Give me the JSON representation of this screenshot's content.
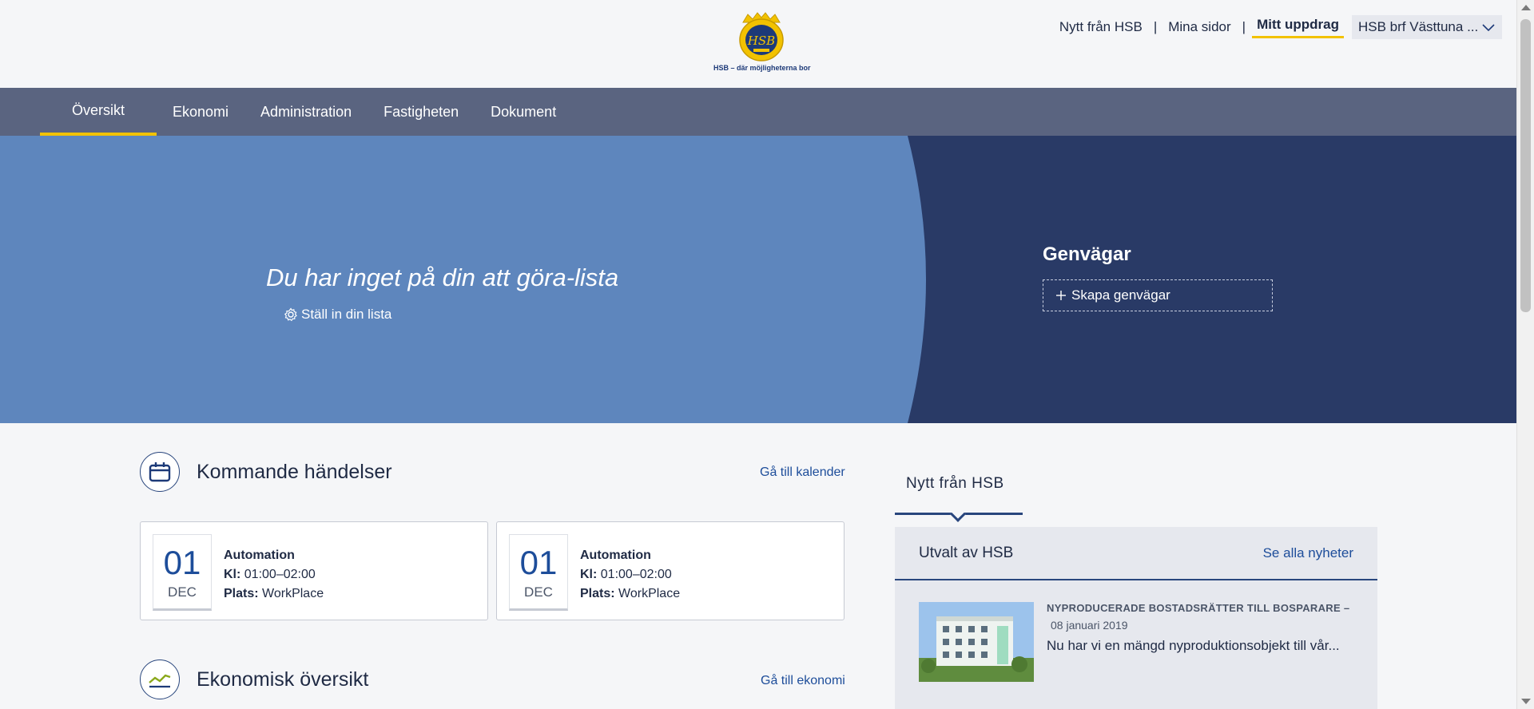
{
  "header": {
    "logo_tagline": "HSB – där möjligheterna bor",
    "topnav": {
      "news": "Nytt från HSB",
      "my_pages": "Mina sidor",
      "my_assignment": "Mitt uppdrag",
      "organization": "HSB brf Västtuna ..."
    }
  },
  "mainnav": {
    "items": [
      "Översikt",
      "Ekonomi",
      "Administration",
      "Fastigheten",
      "Dokument"
    ],
    "active": "Översikt"
  },
  "hero": {
    "todo_title": "Du har inget på din att göra-lista",
    "todo_link": "Ställ in din lista",
    "shortcuts_title": "Genvägar",
    "shortcuts_button": "Skapa genvägar"
  },
  "events": {
    "title": "Kommande händelser",
    "link": "Gå till kalender",
    "items": [
      {
        "day": "01",
        "month": "DEC",
        "name": "Automation",
        "time_label": "Kl:",
        "time": "01:00–02:00",
        "place_label": "Plats:",
        "place": "WorkPlace"
      },
      {
        "day": "01",
        "month": "DEC",
        "name": "Automation",
        "time_label": "Kl:",
        "time": "01:00–02:00",
        "place_label": "Plats:",
        "place": "WorkPlace"
      }
    ]
  },
  "economy": {
    "title": "Ekonomisk översikt",
    "link": "Gå till ekonomi"
  },
  "news": {
    "tab": "Nytt från HSB",
    "panel_title": "Utvalt av HSB",
    "panel_link": "Se alla nyheter",
    "item": {
      "category": "NYPRODUCERADE BOSTADSRÄTTER TILL BOSPARARE",
      "dash": "–",
      "date": "08 januari 2019",
      "text": "Nu har vi en mängd nyproduktionsobjekt till vår..."
    }
  },
  "colors": {
    "nav_bg": "#5a6480",
    "accent_yellow": "#f2c200",
    "hero_light": "#5e86bd",
    "hero_dark": "#293a66",
    "link_blue": "#1d4d9a"
  }
}
